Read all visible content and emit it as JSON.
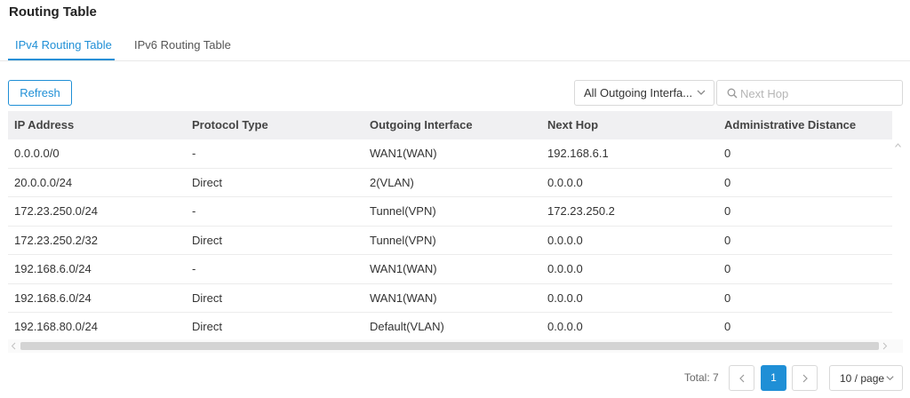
{
  "page": {
    "title": "Routing Table"
  },
  "tabs": [
    {
      "label": "IPv4 Routing Table",
      "active": true
    },
    {
      "label": "IPv6 Routing Table",
      "active": false
    }
  ],
  "toolbar": {
    "refresh_label": "Refresh",
    "interface_select_value": "All Outgoing Interfa...",
    "search_placeholder": "Next Hop",
    "search_value": ""
  },
  "table": {
    "headers": [
      "IP Address",
      "Protocol Type",
      "Outgoing Interface",
      "Next Hop",
      "Administrative Distance"
    ],
    "rows": [
      [
        "0.0.0.0/0",
        "-",
        "WAN1(WAN)",
        "192.168.6.1",
        "0"
      ],
      [
        "20.0.0.0/24",
        "Direct",
        "2(VLAN)",
        "0.0.0.0",
        "0"
      ],
      [
        "172.23.250.0/24",
        "-",
        "Tunnel(VPN)",
        "172.23.250.2",
        "0"
      ],
      [
        "172.23.250.2/32",
        "Direct",
        "Tunnel(VPN)",
        "0.0.0.0",
        "0"
      ],
      [
        "192.168.6.0/24",
        "-",
        "WAN1(WAN)",
        "0.0.0.0",
        "0"
      ],
      [
        "192.168.6.0/24",
        "Direct",
        "WAN1(WAN)",
        "0.0.0.0",
        "0"
      ],
      [
        "192.168.80.0/24",
        "Direct",
        "Default(VLAN)",
        "0.0.0.0",
        "0"
      ]
    ]
  },
  "pagination": {
    "total_label": "Total: 7",
    "current_page": "1",
    "page_size_label": "10 / page",
    "prev_icon": "chevron-left-icon",
    "next_icon": "chevron-right-icon"
  },
  "colors": {
    "accent": "#1f8fd6",
    "header_bg": "#f0f0f2",
    "border": "#d9d9d9"
  }
}
